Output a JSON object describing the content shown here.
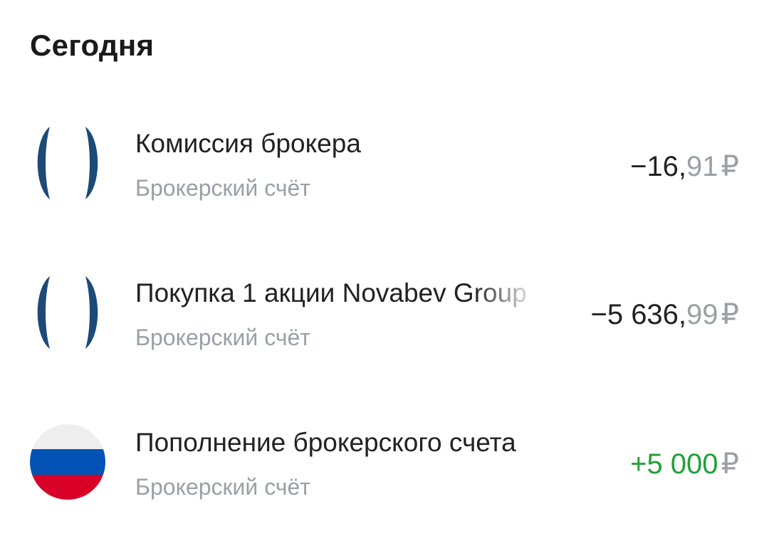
{
  "section": {
    "title": "Сегодня"
  },
  "operations": [
    {
      "title": "Комиссия брокера",
      "subtitle": "Брокерский счёт",
      "amount_int": "−16,",
      "amount_frac": "91",
      "currency": "₽",
      "icon": "broker-logo-icon"
    },
    {
      "title": "Покупка 1 акции Novabev Group",
      "subtitle": "Брокерский счёт",
      "amount_int": "−5 636,",
      "amount_frac": "99",
      "currency": "₽",
      "icon": "broker-logo-icon"
    },
    {
      "title": "Пополнение брокерского счета",
      "subtitle": "Брокерский счёт",
      "amount_int": "+5 000",
      "amount_frac": "",
      "currency": "₽",
      "icon": "russian-flag-icon"
    }
  ],
  "colors": {
    "positive": "#21a038",
    "secondary_text": "#9aa0a6",
    "logo_blue": "#1d4a78",
    "flag_white": "#eeeeee",
    "flag_blue": "#0052b4",
    "flag_red": "#d80027"
  }
}
